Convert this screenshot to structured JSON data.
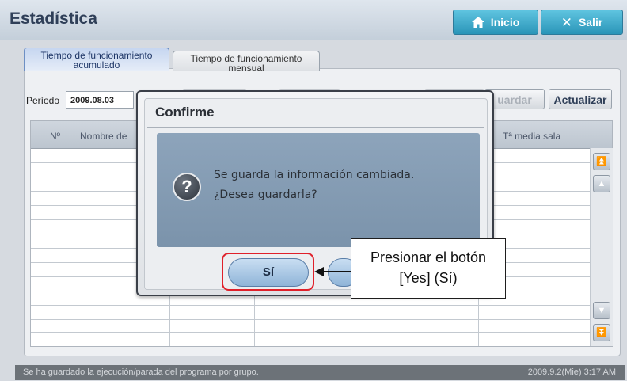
{
  "header": {
    "title": "Estadística",
    "inicio_label": "Inicio",
    "salir_label": "Salir"
  },
  "tabs": [
    {
      "line1": "Tiempo de funcionamiento",
      "line2": "acumulado",
      "active": true
    },
    {
      "line1": "Tiempo de funcionamiento",
      "line2": "mensual",
      "active": false
    }
  ],
  "toolbar": {
    "periodo_label": "Período",
    "periodo_value": "2009.08.03",
    "guardar_label": "uardar",
    "actualizar_label": "Actualizar"
  },
  "table": {
    "columns": [
      "Nº",
      "Nombre de",
      "Tª media sala"
    ]
  },
  "dialog": {
    "title": "Confirme",
    "message_line1": "Se guarda la información cambiada.",
    "message_line2": "¿Desea guardarla?",
    "yes_label": "Sí"
  },
  "callout": {
    "line1": "Presionar el botón",
    "line2": "[Yes] (Sí)"
  },
  "statusbar": {
    "message": "Se ha guardado la ejecución/parada del programa por grupo.",
    "datetime": "2009.9.2(Mie)  3:17 AM"
  },
  "colors": {
    "header_button": "#2a95b8",
    "highlight": "#e0202a",
    "dialog_message_bg": "#8da4bb"
  }
}
